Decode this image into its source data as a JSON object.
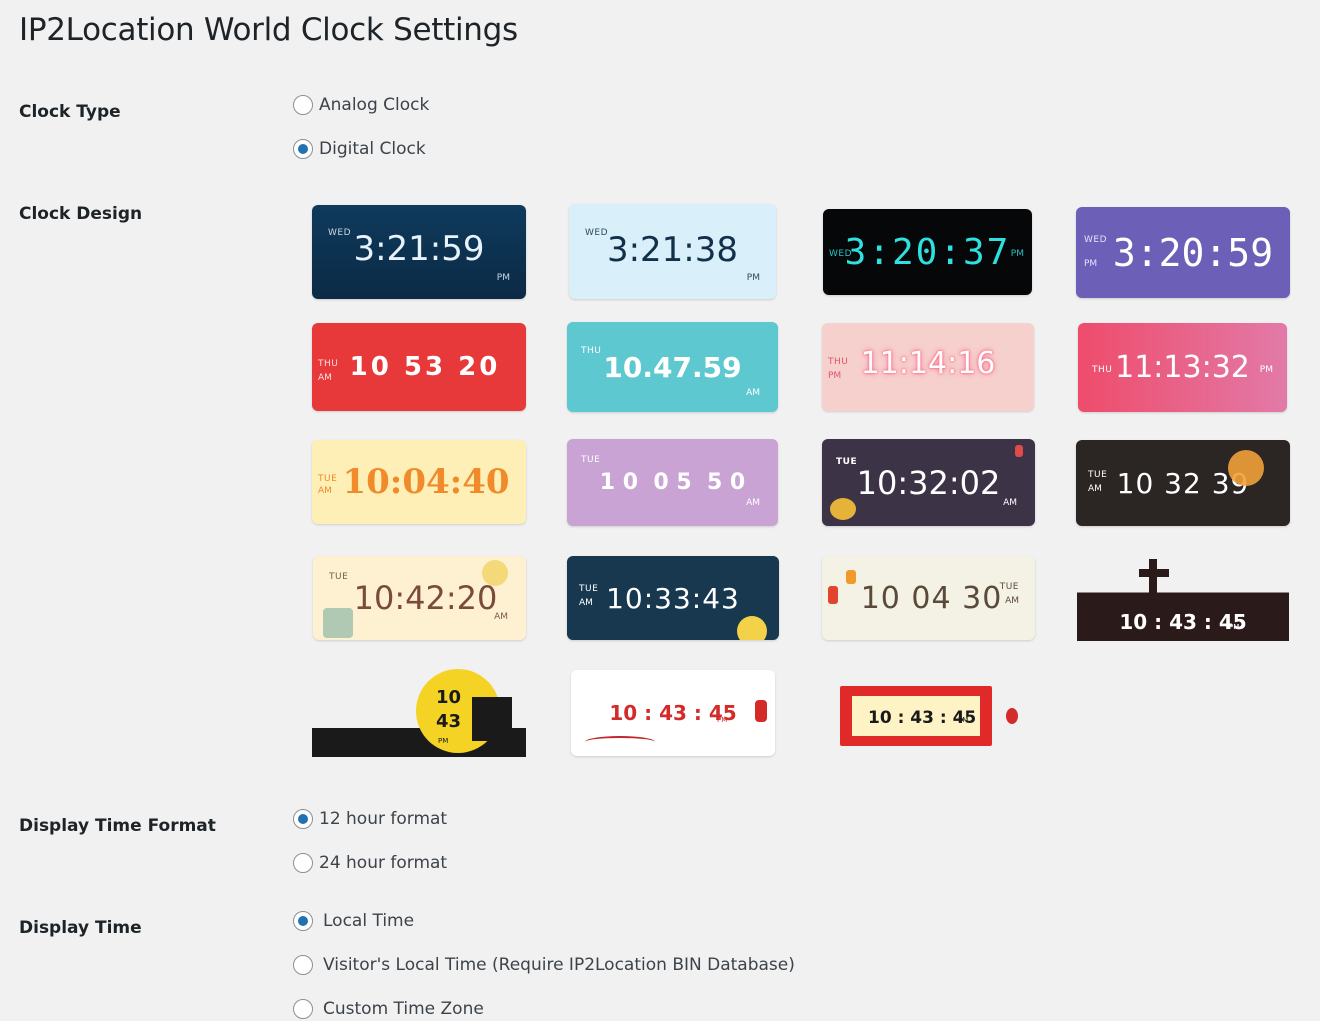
{
  "page": {
    "title": "IP2Location World Clock Settings"
  },
  "clock_type": {
    "label": "Clock Type",
    "options": [
      {
        "label": "Analog Clock",
        "checked": false
      },
      {
        "label": "Digital Clock",
        "checked": true
      }
    ]
  },
  "clock_design": {
    "label": "Clock Design",
    "designs": [
      {
        "day": "WED",
        "time": "3:21:59",
        "ampm": "PM"
      },
      {
        "day": "WED",
        "time": "3:21:38",
        "ampm": "PM"
      },
      {
        "day": "WED",
        "time": "3:20:37",
        "ampm": "PM"
      },
      {
        "day": "WED",
        "time": "3:20:59",
        "ampm": "PM"
      },
      {
        "day": "THU",
        "time": "10 53 20",
        "ampm": "AM"
      },
      {
        "day": "THU",
        "time": "10.47.59",
        "ampm": "AM"
      },
      {
        "day": "THU",
        "time": "11:14:16",
        "ampm": "PM"
      },
      {
        "day": "THU",
        "time": "11:13:32",
        "ampm": "PM"
      },
      {
        "day": "TUE",
        "time": "10:04:40",
        "ampm": "AM"
      },
      {
        "day": "TUE",
        "time": "1 0  0 5  5 0",
        "ampm": "AM"
      },
      {
        "day": "TUE",
        "time": "10:32:02",
        "ampm": "AM"
      },
      {
        "day": "TUE",
        "time": "10 32 39",
        "ampm": "AM"
      },
      {
        "day": "TUE",
        "time": "10:42:20",
        "ampm": "AM"
      },
      {
        "day": "TUE",
        "time": "10:33:43",
        "ampm": "AM"
      },
      {
        "day": "TUE",
        "time": "10 04 30",
        "ampm": "AM"
      },
      {
        "day": "",
        "time": "10 : 43 : 45",
        "ampm": "PM"
      },
      {
        "day": "",
        "time": "10",
        "time2": "43",
        "ampm": "PM"
      },
      {
        "day": "",
        "time": "10 : 43 : 45",
        "ampm": "PM"
      },
      {
        "day": "",
        "time": "10 : 43 : 45",
        "ampm": "PM"
      }
    ]
  },
  "time_format": {
    "label": "Display Time Format",
    "options": [
      {
        "label": "12 hour format",
        "checked": true
      },
      {
        "label": "24 hour format",
        "checked": false
      }
    ]
  },
  "display_time": {
    "label": "Display Time",
    "options": [
      {
        "label": "Local Time",
        "checked": true
      },
      {
        "label": "Visitor's Local Time (Require IP2Location BIN Database)",
        "checked": false
      },
      {
        "label": "Custom Time Zone",
        "checked": false
      }
    ]
  }
}
